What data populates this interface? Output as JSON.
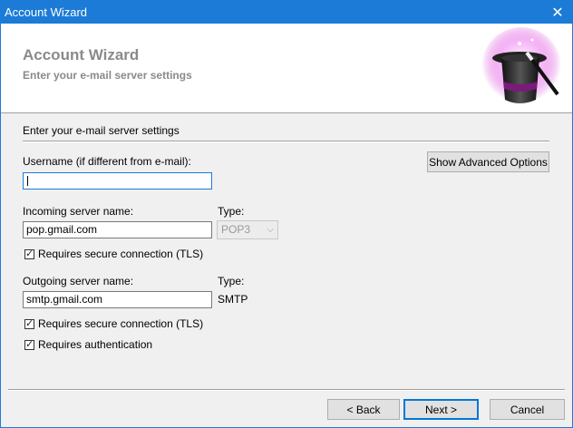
{
  "window": {
    "title": "Account Wizard",
    "close_icon": "close-icon"
  },
  "header": {
    "title": "Account Wizard",
    "subtitle": "Enter your e-mail server settings",
    "art_icon": "wizard-hat-icon"
  },
  "section": {
    "title": "Enter your e-mail server settings"
  },
  "username": {
    "label": "Username (if different from e-mail):",
    "value": ""
  },
  "advanced_button": "Show Advanced Options",
  "incoming": {
    "label": "Incoming server name:",
    "value": "pop.gmail.com",
    "type_label": "Type:",
    "type_value": "POP3",
    "tls_label": "Requires secure connection (TLS)",
    "tls_checked": true
  },
  "outgoing": {
    "label": "Outgoing server name:",
    "value": "smtp.gmail.com",
    "type_label": "Type:",
    "type_value": "SMTP",
    "tls_label": "Requires secure connection (TLS)",
    "tls_checked": true,
    "auth_label": "Requires authentication",
    "auth_checked": true
  },
  "buttons": {
    "back": "< Back",
    "next": "Next >",
    "cancel": "Cancel"
  },
  "colors": {
    "titlebar": "#1c7bd6",
    "header_text": "#8a8a8a",
    "focus": "#1c7bd6"
  }
}
